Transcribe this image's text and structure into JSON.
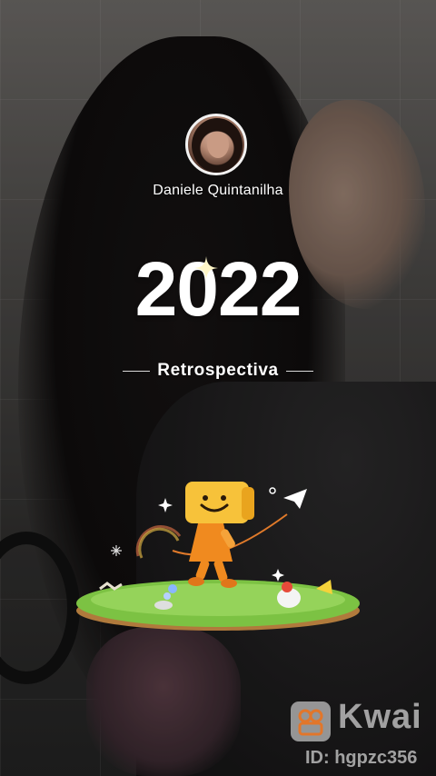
{
  "profile": {
    "username": "Daniele Quintanilha"
  },
  "recap": {
    "year": "2022",
    "label": "Retrospectiva"
  },
  "watermark": {
    "brand": "Kwai",
    "id": "ID: hgpzc356"
  },
  "colors": {
    "text": "#ffffff",
    "accent_yellow": "#f5c23a",
    "character_orange": "#f08a1f",
    "grass": "#7cc243"
  },
  "icons": [
    "sparkle-icon",
    "paper-plane-icon",
    "kwai-logo-icon"
  ]
}
